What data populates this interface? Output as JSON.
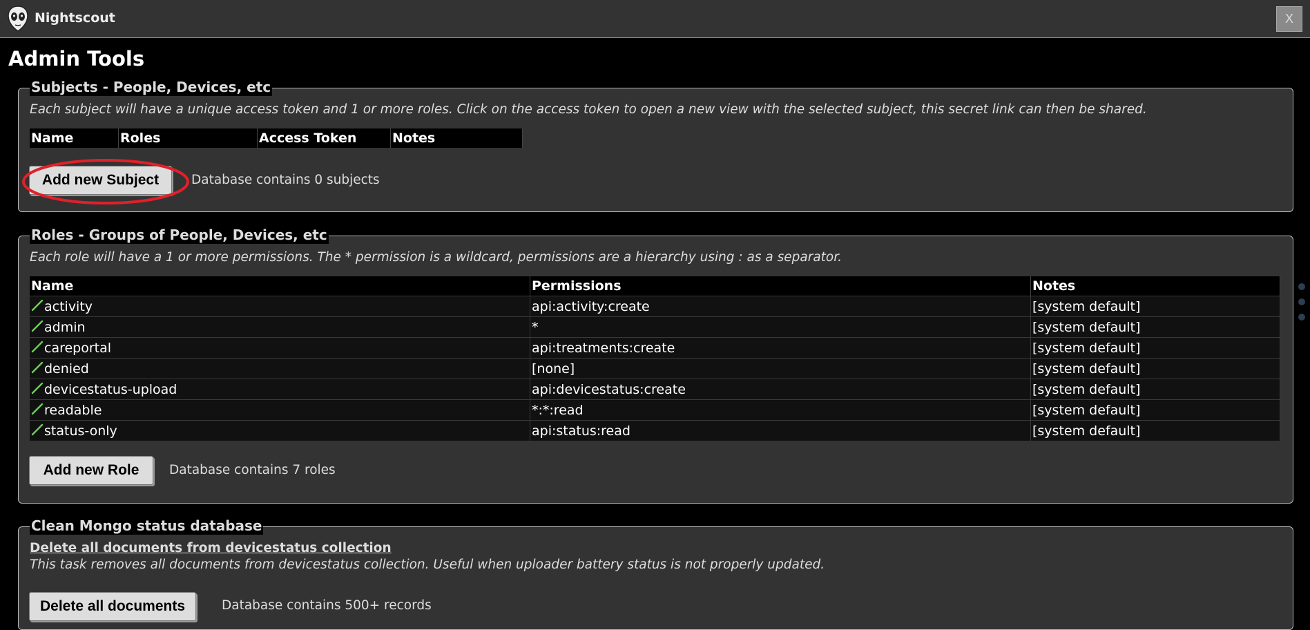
{
  "app": {
    "title": "Nightscout",
    "close_label": "X"
  },
  "page": {
    "title": "Admin Tools"
  },
  "subjects": {
    "legend": "Subjects - People, Devices, etc",
    "description": "Each subject will have a unique access token and 1 or more roles. Click on the access token to open a new view with the selected subject, this secret link can then be shared.",
    "columns": [
      "Name",
      "Roles",
      "Access Token",
      "Notes"
    ],
    "rows": [],
    "add_button": "Add new Subject",
    "count_text": "Database contains 0 subjects"
  },
  "roles": {
    "legend": "Roles - Groups of People, Devices, etc",
    "description": "Each role will have a 1 or more permissions. The * permission is a wildcard, permissions are a hierarchy using : as a separator.",
    "columns": [
      "Name",
      "Permissions",
      "Notes"
    ],
    "rows": [
      {
        "name": "activity",
        "permissions": "api:activity:create",
        "notes": "[system default]"
      },
      {
        "name": "admin",
        "permissions": "*",
        "notes": "[system default]"
      },
      {
        "name": "careportal",
        "permissions": "api:treatments:create",
        "notes": "[system default]"
      },
      {
        "name": "denied",
        "permissions": "[none]",
        "notes": "[system default]"
      },
      {
        "name": "devicestatus-upload",
        "permissions": "api:devicestatus:create",
        "notes": "[system default]"
      },
      {
        "name": "readable",
        "permissions": "*:*:read",
        "notes": "[system default]"
      },
      {
        "name": "status-only",
        "permissions": "api:status:read",
        "notes": "[system default]"
      }
    ],
    "add_button": "Add new Role",
    "count_text": "Database contains 7 roles"
  },
  "cleanup": {
    "legend": "Clean Mongo status database",
    "link": "Delete all documents from devicestatus collection",
    "description": "This task removes all documents from devicestatus collection. Useful when uploader battery status is not properly updated.",
    "button": "Delete all documents",
    "count_text": "Database contains 500+ records"
  },
  "icons": {
    "logo": "nightscout-alien-logo-icon",
    "edit": "pencil-edit-icon"
  },
  "colors": {
    "highlight": "#e0202a",
    "edit_icon": "#6fcf5a",
    "scroll_dots": "#2d3e50"
  }
}
